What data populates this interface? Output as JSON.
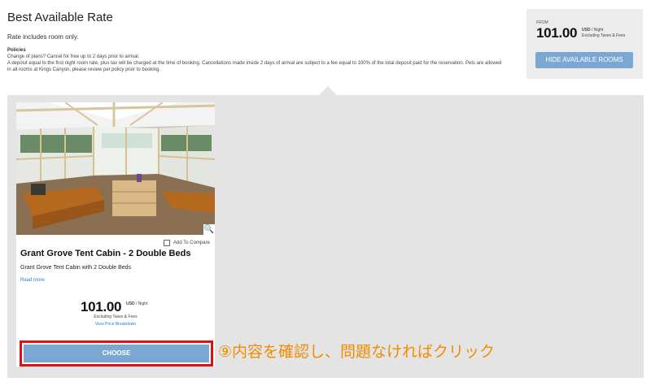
{
  "rate": {
    "title": "Best Available Rate",
    "note": "Rate includes room only.",
    "policies_heading": "Policies",
    "policies_line1": "Change of plans? Cancel for free up to 2 days prior to arrival.",
    "policies_line2": "A deposit equal to the first night room rate, plus tax will be charged at the time of booking. Cancellations made inside 2 days of arrival are subject to a fee equal to 100% of the total deposit paid for the reservation. Pets are allowed in all rooms at Kings Canyon, please review pet policy prior to booking."
  },
  "price_box": {
    "from_label": "FROM",
    "amount": "101.00",
    "currency": "USD",
    "per_night": " / Night",
    "taxes": "Excluding Taxes & Fees",
    "hide_button": "HIDE AVAILABLE ROOMS"
  },
  "room": {
    "compare_label": "Add To Compare",
    "title": "Grant Grove Tent Cabin - 2 Double Beds",
    "description": "Grant Grove Tent Cabin with 2 Double Beds",
    "read_more": "Read more",
    "amount": "101.00",
    "currency": "USD",
    "per_night": " / Night",
    "taxes": "Excluding Taxes & Fees",
    "breakdown": "View Price Breakdown",
    "choose_button": "CHOOSE",
    "zoom_icon": "search-icon"
  },
  "annotation": "⑨内容を確認し、問題なければクリック",
  "colors": {
    "button_blue": "#7ba8d3",
    "highlight_red": "#dd1111",
    "annotation_orange": "#f08c00",
    "panel_grey": "#e4e4e4",
    "link_blue": "#2b7cc4"
  }
}
